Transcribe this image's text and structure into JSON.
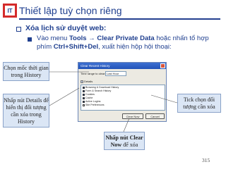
{
  "slide": {
    "title": "Thiết lập tuỳ chọn riêng",
    "bullet1": "Xóa lịch sử duyệt web:",
    "bullet2": {
      "part1": "Vào menu ",
      "tools": "Tools",
      "arrow": " → ",
      "clear_private": "Clear Private Data",
      "part2": " hoặc nhấn tổ hợp phím ",
      "shortcut": "Ctrl+Shift+Del",
      "part3": ", xuất hiện hộp hội thoại:"
    },
    "page_number": "315"
  },
  "dialog": {
    "title": "Clear Recent History",
    "time_range_label": "Time range to clear:",
    "time_range_value": "Last Hour",
    "details_label": "Details",
    "items": [
      {
        "label": "Browsing & Download History",
        "checked": true
      },
      {
        "label": "Form & Search History",
        "checked": true
      },
      {
        "label": "Cookies",
        "checked": true
      },
      {
        "label": "Cache",
        "checked": true
      },
      {
        "label": "Active Logins",
        "checked": true
      },
      {
        "label": "Site Preferences",
        "checked": false
      }
    ],
    "clear_button": "Clear Now",
    "cancel_button": "Cancel"
  },
  "callouts": {
    "time": "Chọn mốc thời gian trong History",
    "details": "Nhấp nút Details để hiển thị đối tượng cần xóa trong History",
    "check": "Tick chọn đối tượng cần xóa",
    "clear_bold": "Nhấp nút Clear Now",
    "clear_rest": " để xóa"
  },
  "colors": {
    "title_blue": "#1f3f8f",
    "callout_bg": "#dbe6f5",
    "callout_border": "#8aa2c8"
  }
}
